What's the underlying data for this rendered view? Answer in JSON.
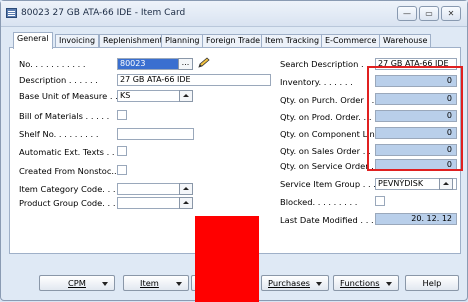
{
  "window": {
    "title": "80023 27 GB ATA-66 IDE - Item Card",
    "minimize": "—",
    "maximize": "▭",
    "close": "✕"
  },
  "tabs": [
    "General",
    "Invoicing",
    "Replenishment",
    "Planning",
    "Foreign Trade",
    "Item Tracking",
    "E-Commerce",
    "Warehouse"
  ],
  "active_tab": "General",
  "left": {
    "no_label": "No. . . . . . . . . . .",
    "no_value": "80023",
    "description_label": "Description . . . . . .",
    "description_value": "27 GB ATA-66 IDE",
    "base_uom_label": "Base Unit of Measure . .",
    "base_uom_value": "KS",
    "bom_label": "Bill of Materials . . . . .",
    "shelf_label": "Shelf No. . . . . . . . .",
    "auto_ext_label": "Automatic Ext. Texts . . .",
    "created_from_label": "Created From Nonstoc...",
    "item_cat_label": "Item Category Code. . .",
    "product_group_label": "Product Group Code. . . ."
  },
  "right": {
    "search_desc_label": "Search Description . . .",
    "search_desc_value": "27 GB ATA-66 IDE",
    "inventory_label": "Inventory. . . . . . .",
    "inventory_value": "0",
    "qty_purch_label": "Qty. on Purch. Order . .",
    "qty_purch_value": "0",
    "qty_prod_label": "Qty. on Prod. Order. . .",
    "qty_prod_value": "0",
    "qty_comp_label": "Qty. on Component Lines",
    "qty_comp_value": "0",
    "qty_sales_label": "Qty. on Sales Order . .",
    "qty_sales_value": "0",
    "qty_service_label": "Qty. on Service Order .",
    "qty_service_value": "0",
    "service_group_label": "Service Item Group . . .",
    "service_group_value": "PEVNÝDISK",
    "blocked_label": "Blocked. . . . . . . . .",
    "last_modified_label": "Last Date Modified . . .",
    "last_modified_value": "20. 12. 12"
  },
  "buttons": {
    "cpm": "CPM",
    "item": "Item",
    "purchases": "Purchases",
    "functions": "Functions",
    "help": "Help"
  },
  "colors": {
    "highlight_border": "#e02020",
    "redaction": "#ff0000",
    "selected_field": "#3a6fd0",
    "readonly_field": "#b9cfea"
  }
}
